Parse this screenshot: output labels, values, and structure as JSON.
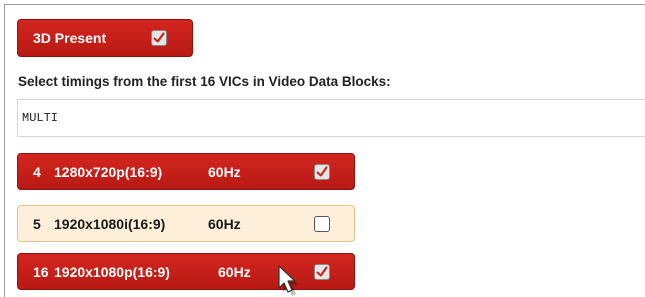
{
  "present3d": {
    "label": "3D Present",
    "checked": true
  },
  "heading": "Select timings from the first 16 VICs in Video Data Blocks:",
  "timing_field": {
    "value": "MULTI"
  },
  "vics": [
    {
      "vic": "4",
      "resolution": "1280x720p(16:9)",
      "rate": "60Hz",
      "checked": true
    },
    {
      "vic": "5",
      "resolution": "1920x1080i(16:9)",
      "rate": "60Hz",
      "checked": false
    },
    {
      "vic": "16",
      "resolution": "1920x1080p(16:9)",
      "rate": "60Hz",
      "checked": true
    }
  ],
  "colors": {
    "selected": "#c41f18",
    "unselected": "#fdefd9",
    "unselected_border": "#e9c48a"
  },
  "icons": {
    "checkbox_mark": "check-icon",
    "pointer": "mouse-cursor-icon"
  }
}
